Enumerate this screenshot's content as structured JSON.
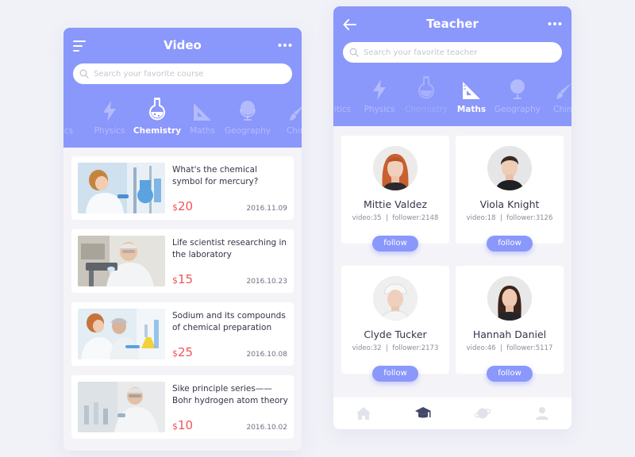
{
  "video_screen": {
    "title": "Video",
    "menu_icon": "menu-icon",
    "more_icon": "more-dots-icon",
    "search": {
      "placeholder": "Search your favorite course",
      "value": ""
    },
    "subjects": [
      {
        "label": "litics",
        "icon": "politics-icon"
      },
      {
        "label": "Physics",
        "icon": "lightning-icon"
      },
      {
        "label": "Chemistry",
        "icon": "flask-icon",
        "active": true
      },
      {
        "label": "Maths",
        "icon": "set-square-icon"
      },
      {
        "label": "Geography",
        "icon": "globe-icon"
      },
      {
        "label": "Chine",
        "icon": "brush-icon"
      }
    ],
    "videos": [
      {
        "title": "What's the chemical symbol for mercury?",
        "currency": "$",
        "price": "20",
        "date": "2016.11.09"
      },
      {
        "title": "Life scientist researching in the laboratory",
        "currency": "$",
        "price": "15",
        "date": "2016.10.23"
      },
      {
        "title": "Sodium and its compounds of chemical preparation",
        "currency": "$",
        "price": "25",
        "date": "2016.10.08"
      },
      {
        "title": "Sike principle series——Bohr hydrogen atom theory",
        "currency": "$",
        "price": "10",
        "date": "2016.10.02"
      }
    ]
  },
  "teacher_screen": {
    "title": "Teacher",
    "back_icon": "arrow-left-icon",
    "more_icon": "more-dots-icon",
    "search": {
      "placeholder": "Search your favorite teacher",
      "value": ""
    },
    "subjects": [
      {
        "label": "litics",
        "icon": "politics-icon"
      },
      {
        "label": "Physics",
        "icon": "lightning-icon"
      },
      {
        "label": "Chemistry",
        "icon": "flask-icon"
      },
      {
        "label": "Maths",
        "icon": "set-square-icon",
        "active": true
      },
      {
        "label": "Geography",
        "icon": "globe-icon"
      },
      {
        "label": "Chine",
        "icon": "brush-icon"
      }
    ],
    "teachers": [
      {
        "name": "Mittie Valdez",
        "video_label": "video:",
        "videos": "35",
        "follower_label": "follower:",
        "followers": "2148",
        "follow_label": "follow"
      },
      {
        "name": "Viola Knight",
        "video_label": "video:",
        "videos": "18",
        "follower_label": "follower:",
        "followers": "3126",
        "follow_label": "follow"
      },
      {
        "name": "Clyde Tucker",
        "video_label": "video:",
        "videos": "32",
        "follower_label": "follower:",
        "followers": "2173",
        "follow_label": "follow"
      },
      {
        "name": "Hannah Daniel",
        "video_label": "video:",
        "videos": "46",
        "follower_label": "follower:",
        "followers": "5117",
        "follow_label": "follow"
      }
    ],
    "tabbar": [
      {
        "icon": "home-icon"
      },
      {
        "icon": "graduation-cap-icon",
        "active": true
      },
      {
        "icon": "planet-icon"
      },
      {
        "icon": "user-icon"
      }
    ]
  },
  "colors": {
    "accent": "#8a97fb",
    "price": "#f1545a",
    "background": "#f1f2f8",
    "tab_inactive": "#e1e3ea",
    "tab_active": "#44486a"
  }
}
